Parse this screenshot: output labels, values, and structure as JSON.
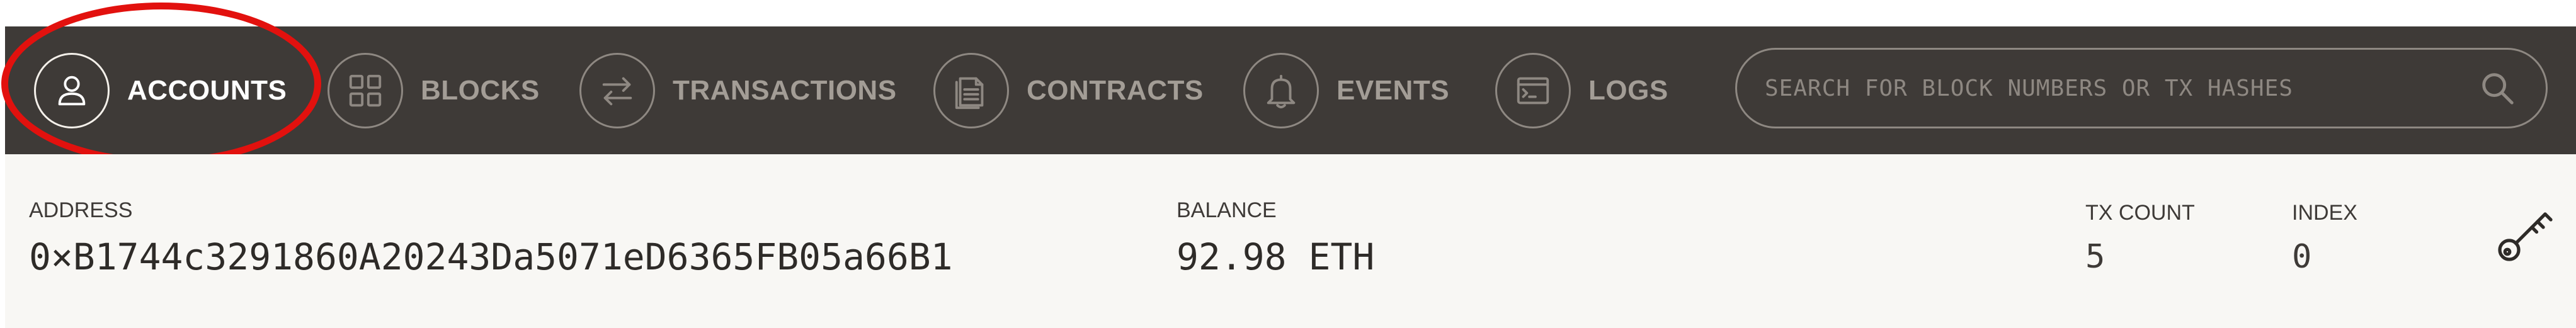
{
  "nav": {
    "items": [
      {
        "label": "ACCOUNTS",
        "icon": "user-icon",
        "active": true
      },
      {
        "label": "BLOCKS",
        "icon": "grid-icon",
        "active": false
      },
      {
        "label": "TRANSACTIONS",
        "icon": "arrows-swap-icon",
        "active": false
      },
      {
        "label": "CONTRACTS",
        "icon": "document-icon",
        "active": false
      },
      {
        "label": "EVENTS",
        "icon": "bell-icon",
        "active": false
      },
      {
        "label": "LOGS",
        "icon": "terminal-icon",
        "active": false
      }
    ],
    "search": {
      "placeholder": "SEARCH FOR BLOCK NUMBERS OR TX HASHES",
      "value": "",
      "icon": "search-icon"
    }
  },
  "account": {
    "address_label": "ADDRESS",
    "address": "0×B1744c3291860A20243Da5071eD6365FB05a66B1",
    "balance_label": "BALANCE",
    "balance": "92.98 ETH",
    "tx_count_label": "TX COUNT",
    "tx_count": "5",
    "index_label": "INDEX",
    "index": "0",
    "key_icon": "key-icon"
  },
  "colors": {
    "navbar_bg": "#3e3a37",
    "nav_inactive": "#a39d96",
    "nav_active": "#ffffff",
    "row_bg": "#f8f7f4",
    "highlight": "#e2110e"
  }
}
